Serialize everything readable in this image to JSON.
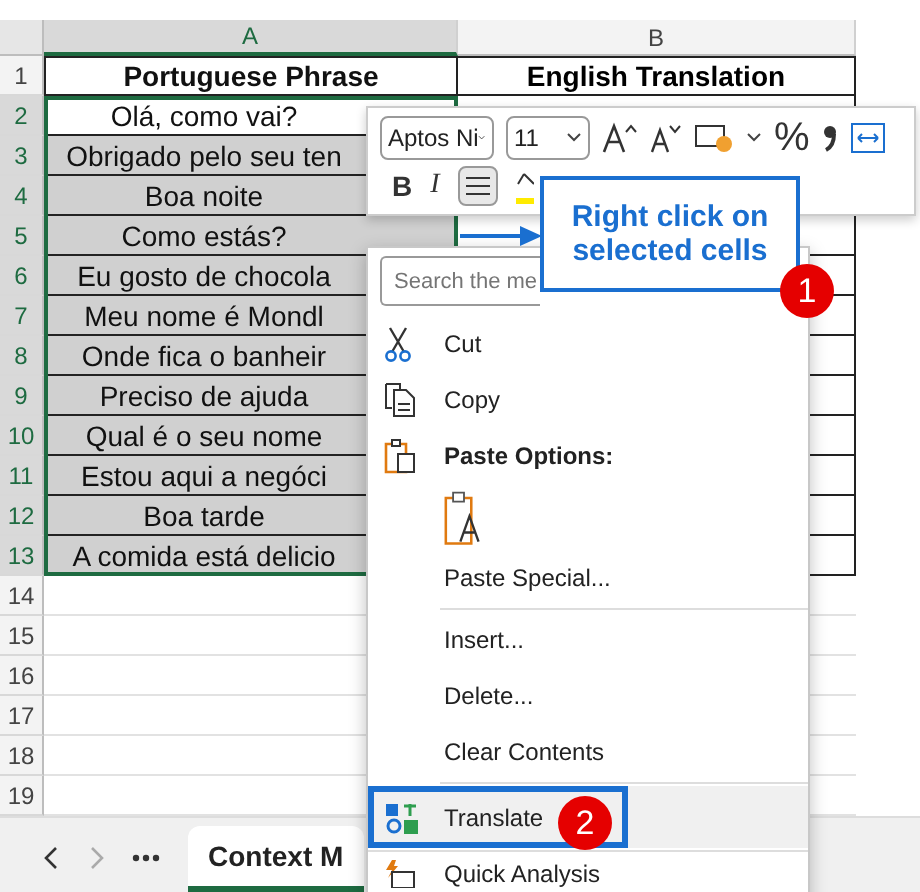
{
  "columns": [
    {
      "label": "A",
      "selected": true
    },
    {
      "label": "B",
      "selected": false
    }
  ],
  "header_row": {
    "number": "1",
    "cells": [
      "Portuguese Phrase",
      "English Translation"
    ]
  },
  "rows": [
    {
      "number": "2",
      "phrase": "Olá, como vai?",
      "selected": true,
      "active": true
    },
    {
      "number": "3",
      "phrase": "Obrigado pelo seu ten",
      "selected": true,
      "active": false
    },
    {
      "number": "4",
      "phrase": "Boa noite",
      "selected": true,
      "active": false
    },
    {
      "number": "5",
      "phrase": "Como estás?",
      "selected": true,
      "active": false
    },
    {
      "number": "6",
      "phrase": "Eu gosto de chocola",
      "selected": true,
      "active": false
    },
    {
      "number": "7",
      "phrase": "Meu nome é Mondl",
      "selected": true,
      "active": false
    },
    {
      "number": "8",
      "phrase": "Onde fica o banheir",
      "selected": true,
      "active": false
    },
    {
      "number": "9",
      "phrase": "Preciso de ajuda",
      "selected": true,
      "active": false
    },
    {
      "number": "10",
      "phrase": "Qual é o seu nome",
      "selected": true,
      "active": false
    },
    {
      "number": "11",
      "phrase": "Estou aqui a negóci",
      "selected": true,
      "active": false
    },
    {
      "number": "12",
      "phrase": "Boa tarde",
      "selected": true,
      "active": false
    },
    {
      "number": "13",
      "phrase": "A comida está delicio",
      "selected": true,
      "active": false
    }
  ],
  "empty_rows": [
    "14",
    "15",
    "16",
    "17",
    "18",
    "19"
  ],
  "mini_toolbar": {
    "font_name": "Aptos Ni",
    "font_size": "11",
    "bold": "B",
    "italic": "I",
    "percent": "%",
    "center_align_pressed": true
  },
  "context_menu": {
    "search_placeholder": "Search the me",
    "items": [
      {
        "kind": "cut",
        "label": "Cut",
        "highlighted": false
      },
      {
        "kind": "copy",
        "label": "Copy",
        "highlighted": false
      },
      {
        "kind": "heading",
        "label": "Paste Options:",
        "highlighted": false
      },
      {
        "kind": "paste-icon"
      },
      {
        "kind": "command",
        "label": "Paste Special...",
        "highlighted": false
      },
      {
        "kind": "separator"
      },
      {
        "kind": "command",
        "label": "Insert...",
        "highlighted": false
      },
      {
        "kind": "command",
        "label": "Delete...",
        "highlighted": false
      },
      {
        "kind": "command",
        "label": "Clear Contents",
        "highlighted": false
      },
      {
        "kind": "separator"
      },
      {
        "kind": "translate",
        "label": "Translate",
        "highlighted": true,
        "badge": "2"
      },
      {
        "kind": "separator"
      },
      {
        "kind": "analysis",
        "label": "Quick Analysis",
        "highlighted": false
      }
    ]
  },
  "callout": {
    "text": "Right click on selected cells",
    "badge": "1"
  },
  "sheet_tabs": [
    {
      "label": "Context M",
      "selected": true
    }
  ]
}
